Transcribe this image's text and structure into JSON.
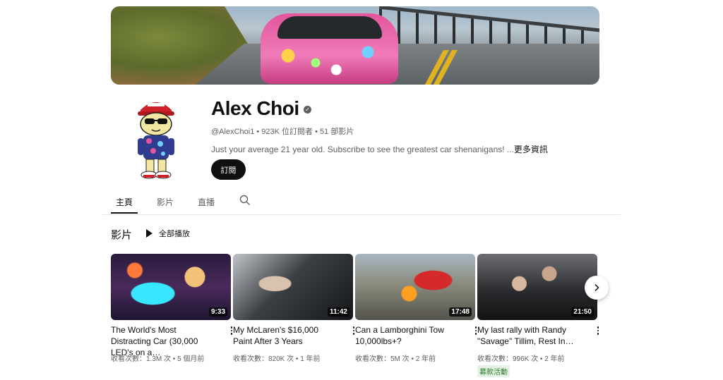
{
  "channel": {
    "name": "Alex Choi",
    "handle": "@AlexChoi1",
    "subscribers": "923K 位訂閱者",
    "video_count": "51 部影片",
    "description": "Just your average 21 year old. Subscribe to see the greatest car shenanigans! ...",
    "more_label": "更多資訊",
    "subscribe_label": "訂閱",
    "verified": true
  },
  "tabs": [
    {
      "label": "主頁",
      "active": true
    },
    {
      "label": "影片",
      "active": false
    },
    {
      "label": "直播",
      "active": false
    }
  ],
  "section": {
    "title": "影片",
    "play_all_label": "全部播放"
  },
  "videos": [
    {
      "title": "The World's Most Distracting Car (30,000 LED's on a…",
      "duration": "9:33",
      "views": "收看次數：1.3M 次",
      "age": "5 個月前",
      "badge": ""
    },
    {
      "title": "My McLaren's $16,000 Paint After 3 Years",
      "duration": "11:42",
      "views": "收看次數：820K 次",
      "age": "1 年前",
      "badge": ""
    },
    {
      "title": "Can a Lamborghini Tow 10,000lbs+?",
      "duration": "17:48",
      "views": "收看次數：5M 次",
      "age": "2 年前",
      "badge": ""
    },
    {
      "title": "My last rally with Randy \"Savage\" Tillim, Rest In…",
      "duration": "21:50",
      "views": "收看次數：996K 次",
      "age": "2 年前",
      "badge": "募款活動"
    }
  ],
  "colors": {
    "text_primary": "#0f0f0f",
    "text_secondary": "#606060",
    "badge_green": "#2b7a2b"
  }
}
